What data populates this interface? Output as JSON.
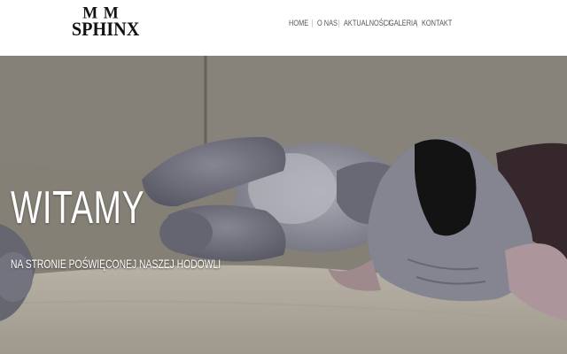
{
  "logo": {
    "top_text": "M M",
    "bottom_text": "SPHINX"
  },
  "nav": {
    "items": [
      {
        "label": "HOME"
      },
      {
        "label": "O NAS"
      },
      {
        "label": "AKTUALNOŚCI"
      },
      {
        "label": "GALERIA"
      },
      {
        "label": "KONTAKT"
      }
    ]
  },
  "hero": {
    "title": "WITAMY",
    "subtitle": "NA STRONIE POŚWIĘCONEJ NASZEJ HODOWLI",
    "image": "sleeping-sphynx-cat-photo"
  },
  "colors": {
    "header_bg": "#ffffff",
    "nav_text": "#555555",
    "hero_text": "#ffffff",
    "logo_text": "#111111"
  }
}
